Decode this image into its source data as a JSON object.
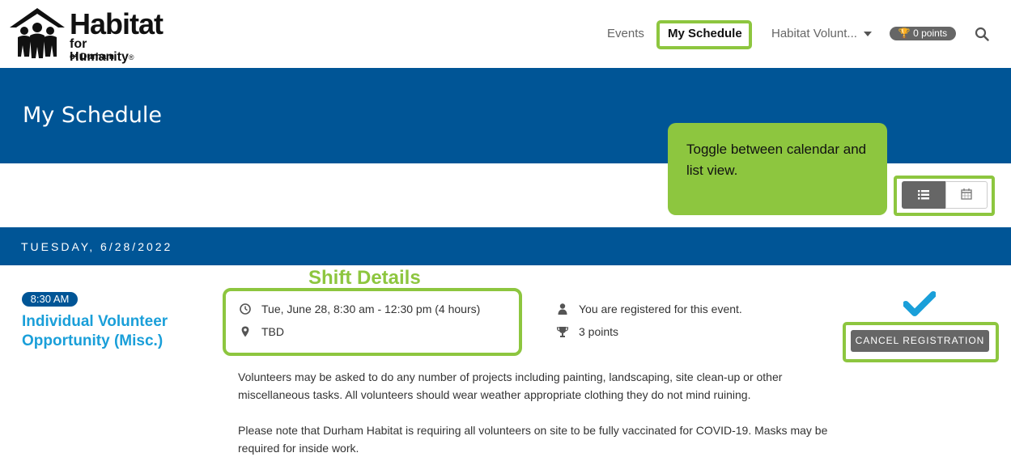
{
  "header": {
    "logo": {
      "line1": "Habitat",
      "line2": "for Humanity",
      "registered": "®",
      "line3": "of Durham"
    },
    "nav": {
      "events": "Events",
      "my_schedule": "My Schedule",
      "org": "Habitat Volunt...",
      "points": "0 points"
    }
  },
  "banner": {
    "title": "My Schedule"
  },
  "callout": {
    "text": "Toggle between calendar and list view."
  },
  "day": {
    "label": "TUESDAY, 6/28/2022"
  },
  "annotation": {
    "shift_details": "Shift Details"
  },
  "event": {
    "time": "8:30 AM",
    "title": "Individual Volunteer Opportunity (Misc.)",
    "datetime": "Tue, June 28, 8:30 am - 12:30 pm (4 hours)",
    "location": "TBD",
    "registration_status": "You are registered for this event.",
    "points": "3 points",
    "cancel_label": "CANCEL REGISTRATION",
    "description1": "Volunteers may be asked to do any number of projects including painting, landscaping, site clean-up or other miscellaneous tasks. All volunteers should wear weather appropriate clothing they do not mind ruining.",
    "description2": "Please note that Durham Habitat is requiring all volunteers on site to be fully vaccinated for COVID-19. Masks may be required for inside work."
  },
  "colors": {
    "brand_blue": "#005596",
    "highlight_green": "#8dc63f",
    "link_blue": "#1a9fd9",
    "check_blue": "#1a9fd9"
  }
}
